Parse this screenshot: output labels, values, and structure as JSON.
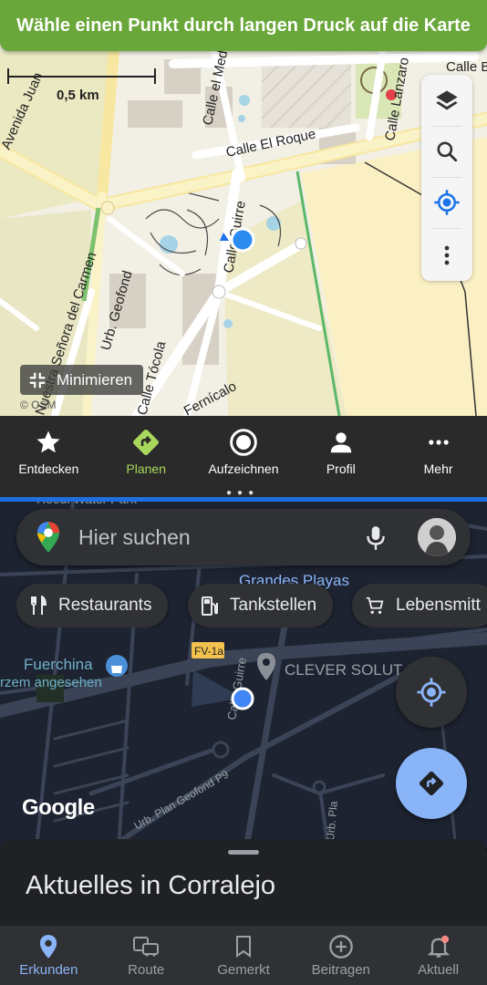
{
  "top_app": {
    "banner": "Wähle einen Punkt durch langen Druck auf die Karte",
    "scale_label": "0,5 km",
    "map_labels": [
      "Avenida Juan",
      "Calle el Med",
      "Calle Be",
      "Calle Lanzaro",
      "Calle El Roque",
      "Calle Guirre",
      "Urb. Geofond",
      "Nuestra Señora del Carmen",
      "Calle Tócola",
      "Fernícalo"
    ],
    "minimize_label": "Minimieren",
    "attribution": "© OSM",
    "nav": [
      {
        "label": "Entdecken",
        "icon": "star-icon"
      },
      {
        "label": "Planen",
        "icon": "directions-icon",
        "active": true
      },
      {
        "label": "Aufzeichnen",
        "icon": "record-icon"
      },
      {
        "label": "Profil",
        "icon": "person-icon"
      },
      {
        "label": "Mehr",
        "icon": "more-horizontal-icon"
      }
    ]
  },
  "bottom_app": {
    "search_placeholder": "Hier suchen",
    "chips": [
      {
        "label": "Restaurants",
        "icon": "restaurant-icon"
      },
      {
        "label": "Tankstellen",
        "icon": "gas-station-icon"
      },
      {
        "label": "Lebensmitt",
        "icon": "cart-icon"
      }
    ],
    "map_labels": [
      "Grandes Playas",
      "Fuerchina",
      "rzem angesehen",
      "CLEVER SOLUT",
      "FV-1a",
      "Calle Guirre",
      "Urb. Plan Geofond P9",
      "Urb. Pla",
      "Hoodi Water Park"
    ],
    "logo": "Google",
    "sheet_title": "Aktuelles in Corralejo",
    "nav": [
      {
        "label": "Erkunden",
        "icon": "location-pin-icon",
        "active": true
      },
      {
        "label": "Route",
        "icon": "commute-icon"
      },
      {
        "label": "Gemerkt",
        "icon": "bookmark-icon"
      },
      {
        "label": "Beitragen",
        "icon": "add-circle-icon"
      },
      {
        "label": "Aktuell",
        "icon": "bell-icon"
      }
    ]
  },
  "colors": {
    "banner_green": "#6aa73a",
    "active_green": "#a8d85b",
    "divider_blue": "#1e6fe0",
    "gmaps_blue": "#8ab4f8",
    "dark_surface": "#303134"
  }
}
